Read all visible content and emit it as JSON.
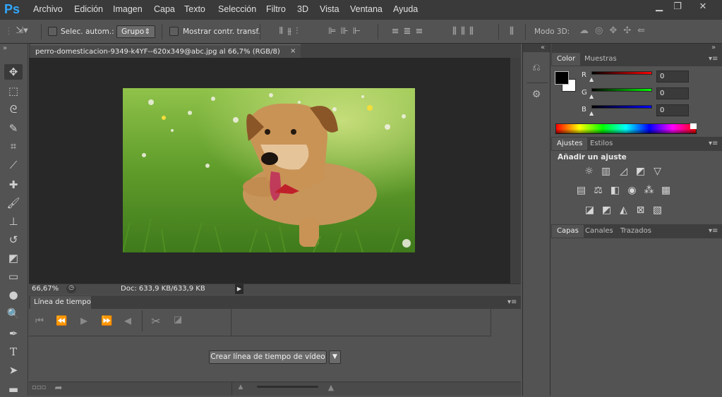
{
  "app": {
    "logo": "Ps"
  },
  "menu": [
    "Archivo",
    "Edición",
    "Imagen",
    "Capa",
    "Texto",
    "Selección",
    "Filtro",
    "3D",
    "Vista",
    "Ventana",
    "Ayuda"
  ],
  "options": {
    "auto_select_label": "Selec. autom.:",
    "group_value": "Grupo",
    "show_transform_label": "Mostrar contr. transf.",
    "mode3d_label": "Modo 3D:"
  },
  "document": {
    "tab_title": "perro-domesticacion-9349-k4YF--620x349@abc.jpg al 66,7% (RGB/8)",
    "zoom": "66,67%",
    "doc_size": "Doc: 633,9 KB/633,9 KB"
  },
  "timeline": {
    "tab": "Línea de tiempo",
    "create_button": "Crear línea de tiempo de vídeo"
  },
  "color_panel": {
    "tabs": [
      "Color",
      "Muestras"
    ],
    "channels": [
      {
        "label": "R",
        "value": "0"
      },
      {
        "label": "G",
        "value": "0"
      },
      {
        "label": "B",
        "value": "0"
      }
    ],
    "foreground": "#000000",
    "background": "#ffffff"
  },
  "adjust_panel": {
    "tabs": [
      "Ajustes",
      "Estilos"
    ],
    "heading": "Añadir un ajuste"
  },
  "layers_panel": {
    "tabs": [
      "Capas",
      "Canales",
      "Trazados"
    ]
  },
  "icons": [
    "move-icon",
    "marquee-icon",
    "lasso-icon",
    "quick-select-icon",
    "crop-icon",
    "eyedropper-icon",
    "healing-icon",
    "brush-icon",
    "stamp-icon",
    "history-brush-icon",
    "eraser-icon",
    "gradient-icon",
    "blur-icon",
    "dodge-icon",
    "pen-icon",
    "type-icon",
    "path-select-icon",
    "rectangle-icon"
  ]
}
